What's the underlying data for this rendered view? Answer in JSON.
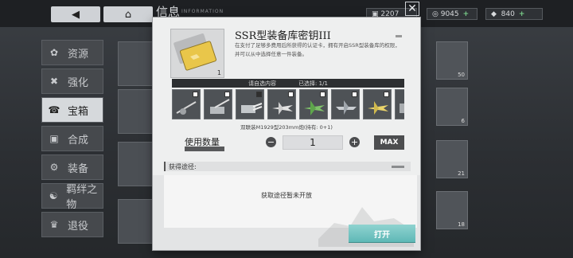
{
  "header": {
    "title": "信息",
    "title_en": "INFORMATION",
    "back_icon": "back-arrow-icon",
    "home_icon": "home-icon",
    "resources": [
      {
        "name": "fuel",
        "value": "2207",
        "icon": "fuel-icon"
      },
      {
        "name": "coins",
        "value": "9045",
        "icon": "coin-icon"
      },
      {
        "name": "gems",
        "value": "840",
        "icon": "gem-icon"
      }
    ]
  },
  "sidebar": {
    "items": [
      {
        "label": "资源",
        "icon": "resource-icon",
        "active": false
      },
      {
        "label": "强化",
        "icon": "wrench-icon",
        "active": false
      },
      {
        "label": "宝箱",
        "icon": "chest-icon",
        "active": true
      },
      {
        "label": "合成",
        "icon": "synthesis-icon",
        "active": false
      },
      {
        "label": "装备",
        "icon": "equipment-icon",
        "active": false
      },
      {
        "label": "羁绊之物",
        "icon": "bond-icon",
        "active": false
      },
      {
        "label": "退役",
        "icon": "retire-icon",
        "active": false
      }
    ]
  },
  "background_grid": {
    "right_column": [
      {
        "label": "",
        "count": "50"
      },
      {
        "label": "",
        "count": "6"
      },
      {
        "label": "",
        "count": "21"
      },
      {
        "label": "",
        "count": "18"
      }
    ]
  },
  "dialog": {
    "item_name": "SSR型装备库密钥III",
    "item_count": "1",
    "item_desc": "在支付了足够多费用后所获得的认证卡，拥有开启SSR型装备库的权限，并可以从中选择任意一件装备。",
    "select_title": "请自选内容",
    "selected_text": "已选择: 1/1",
    "option_name": "双联装M1929型203mm炮(持有: 0+1)",
    "qty_label": "使用数量",
    "qty_sub": "",
    "qty_value": "1",
    "minus_icon": "minus-icon",
    "plus_icon": "plus-icon",
    "max_label": "MAX",
    "acquire_head": "获得途径:",
    "acquire_text": "获取途径暂未开放",
    "open_label": "打开",
    "close_icon": "close-icon"
  },
  "options": [
    {
      "icon": "anti-aircraft-gun-icon"
    },
    {
      "icon": "naval-gun-icon"
    },
    {
      "icon": "twin-turret-icon"
    },
    {
      "icon": "fighter-plane-icon"
    },
    {
      "icon": "green-fighter-icon"
    },
    {
      "icon": "dive-bomber-icon"
    },
    {
      "icon": "yellow-fighter-icon"
    },
    {
      "icon": "partial-item-icon"
    }
  ]
}
